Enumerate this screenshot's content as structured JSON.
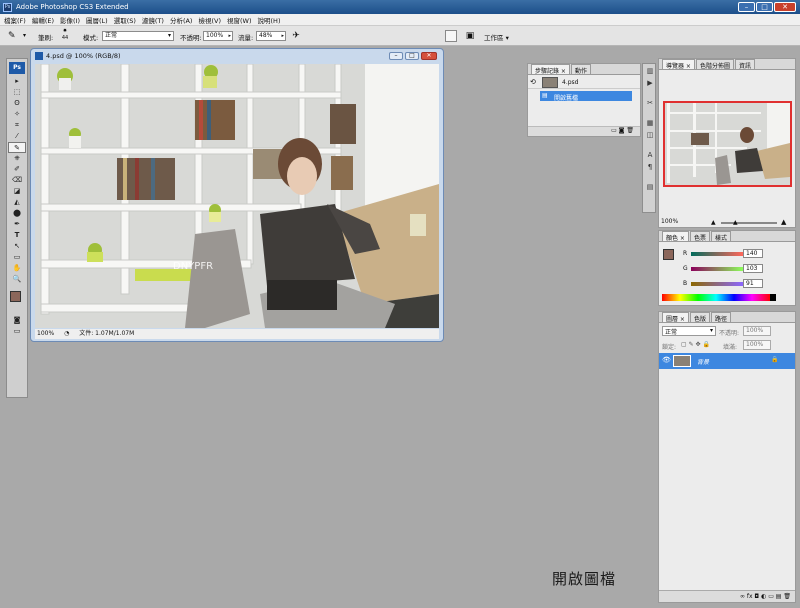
{
  "window": {
    "title": "Adobe Photoshop CS3 Extended",
    "min_btn": "–",
    "max_btn": "□",
    "close_btn": "✕"
  },
  "menu": [
    "檔案(F)",
    "編輯(E)",
    "影像(I)",
    "圖層(L)",
    "選取(S)",
    "濾鏡(T)",
    "分析(A)",
    "檢視(V)",
    "視窗(W)",
    "說明(H)"
  ],
  "options": {
    "brush_label": "筆刷:",
    "brush_size": "44",
    "mode_label": "模式:",
    "mode_value": "正常",
    "opacity_label": "不透明:",
    "opacity_value": "100%",
    "flow_label": "流量:",
    "flow_value": "48%",
    "workspace_label": "工作區 ▾"
  },
  "tools": [
    "▸",
    "⬚",
    "ʘ",
    "✧",
    "⌗",
    "⁄",
    "✎",
    "⎈",
    "✐",
    "⌫",
    "◪",
    "◭",
    "⬤",
    "✒",
    "T",
    "↖",
    "▭",
    "✋",
    "🔍"
  ],
  "document": {
    "title": "4.psd @ 100% (RGB/8)",
    "zoom": "100%",
    "file_info": "文件: 1.07M/1.07M",
    "photo_watermark": "DNYPFR"
  },
  "history_panel": {
    "tabs": [
      "步驟記錄 ×",
      "動作"
    ],
    "snapshot": "4.psd",
    "step": "開啟舊檔"
  },
  "navigator_panel": {
    "tabs": [
      "導覽器 ×",
      "色階分佈圖",
      "資訊"
    ],
    "zoom": "100%"
  },
  "color_panel": {
    "tabs": [
      "顏色 ×",
      "色票",
      "樣式"
    ],
    "r_label": "R",
    "r_value": "140",
    "g_label": "G",
    "g_value": "103",
    "b_label": "B",
    "b_value": "91",
    "foreground": "#8c675b"
  },
  "layers_panel": {
    "tabs": [
      "圖層 ×",
      "色版",
      "路徑"
    ],
    "blend_mode": "正常",
    "opacity_label": "不透明:",
    "opacity_value": "100%",
    "lock_label": "鎖定:",
    "fill_label": "填滿:",
    "fill_value": "100%",
    "layer_name": "背景",
    "footer_icons": "∞  fx  ◘  ◐  ▭  ▤  🗑"
  },
  "bottom_caption": "開啟圖檔"
}
